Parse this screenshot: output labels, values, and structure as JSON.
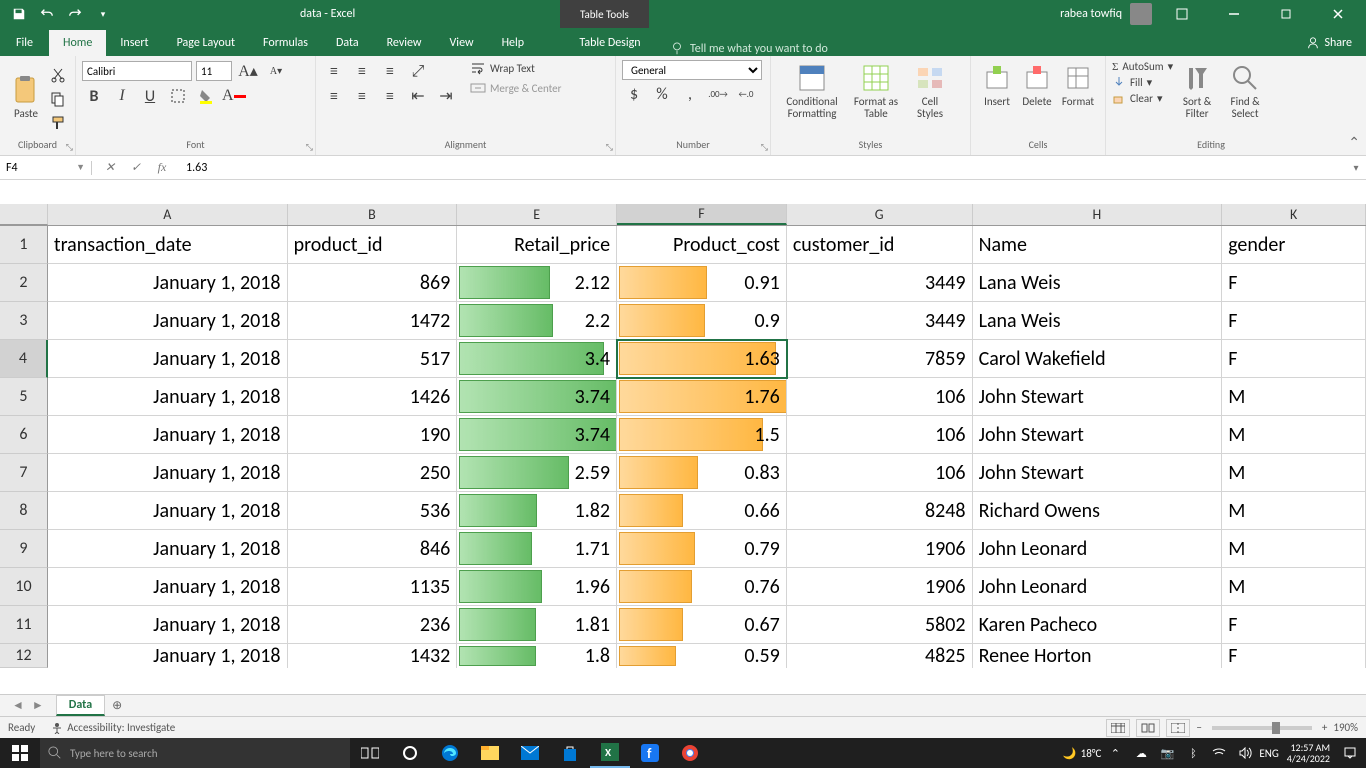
{
  "title_bar": {
    "doc_title": "data - Excel",
    "table_tools": "Table Tools",
    "user_name": "rabea towfiq"
  },
  "tabs": {
    "file": "File",
    "home": "Home",
    "insert": "Insert",
    "page_layout": "Page Layout",
    "formulas": "Formulas",
    "data": "Data",
    "review": "Review",
    "view": "View",
    "help": "Help",
    "table_design": "Table Design",
    "tell_me": "Tell me what you want to do",
    "share": "Share"
  },
  "ribbon": {
    "clipboard": {
      "label": "Clipboard",
      "paste": "Paste"
    },
    "font": {
      "label": "Font",
      "name": "Calibri",
      "size": "11"
    },
    "alignment": {
      "label": "Alignment",
      "wrap": "Wrap Text",
      "merge": "Merge & Center"
    },
    "number": {
      "label": "Number",
      "format": "General"
    },
    "styles": {
      "label": "Styles",
      "cond": "Conditional Formatting",
      "table": "Format as Table",
      "cell": "Cell Styles"
    },
    "cells": {
      "label": "Cells",
      "insert": "Insert",
      "delete": "Delete",
      "format": "Format"
    },
    "editing": {
      "label": "Editing",
      "autosum": "AutoSum",
      "fill": "Fill",
      "clear": "Clear",
      "sort": "Sort & Filter",
      "find": "Find & Select"
    }
  },
  "formula_bar": {
    "name_box": "F4",
    "formula": "1.63"
  },
  "columns": {
    "A": "A",
    "B": "B",
    "E": "E",
    "F": "F",
    "G": "G",
    "H": "H",
    "K": "K"
  },
  "headers": {
    "A": "transaction_date",
    "B": "product_id",
    "E": "Retail_price",
    "F": "Product_cost",
    "G": "customer_id",
    "H": "Name",
    "K": "gender"
  },
  "rows": [
    {
      "n": "2",
      "A": "January 1, 2018",
      "B": "869",
      "E": "2.12",
      "F": "0.91",
      "G": "3449",
      "H": "Lana Weis",
      "K": "F"
    },
    {
      "n": "3",
      "A": "January 1, 2018",
      "B": "1472",
      "E": "2.2",
      "F": "0.9",
      "G": "3449",
      "H": "Lana Weis",
      "K": "F"
    },
    {
      "n": "4",
      "A": "January 1, 2018",
      "B": "517",
      "E": "3.4",
      "F": "1.63",
      "G": "7859",
      "H": "Carol Wakefield",
      "K": "F"
    },
    {
      "n": "5",
      "A": "January 1, 2018",
      "B": "1426",
      "E": "3.74",
      "F": "1.76",
      "G": "106",
      "H": "John Stewart",
      "K": "M"
    },
    {
      "n": "6",
      "A": "January 1, 2018",
      "B": "190",
      "E": "3.74",
      "F": "1.5",
      "G": "106",
      "H": "John Stewart",
      "K": "M"
    },
    {
      "n": "7",
      "A": "January 1, 2018",
      "B": "250",
      "E": "2.59",
      "F": "0.83",
      "G": "106",
      "H": "John Stewart",
      "K": "M"
    },
    {
      "n": "8",
      "A": "January 1, 2018",
      "B": "536",
      "E": "1.82",
      "F": "0.66",
      "G": "8248",
      "H": "Richard Owens",
      "K": "M"
    },
    {
      "n": "9",
      "A": "January 1, 2018",
      "B": "846",
      "E": "1.71",
      "F": "0.79",
      "G": "1906",
      "H": "John Leonard",
      "K": "M"
    },
    {
      "n": "10",
      "A": "January 1, 2018",
      "B": "1135",
      "E": "1.96",
      "F": "0.76",
      "G": "1906",
      "H": "John Leonard",
      "K": "M"
    },
    {
      "n": "11",
      "A": "January 1, 2018",
      "B": "236",
      "E": "1.81",
      "F": "0.67",
      "G": "5802",
      "H": "Karen Pacheco",
      "K": "F"
    },
    {
      "n": "12",
      "A": "January 1, 2018",
      "B": "1432",
      "E": "1.8",
      "F": "0.59",
      "G": "4825",
      "H": "Renee Horton",
      "K": "F"
    }
  ],
  "row_header_1": "1",
  "data_bar_max": {
    "E": 3.74,
    "F": 1.76
  },
  "sheet_tabs": {
    "active": "Data"
  },
  "status_bar": {
    "ready": "Ready",
    "accessibility": "Accessibility: Investigate",
    "zoom": "190%"
  },
  "taskbar": {
    "search_placeholder": "Type here to search",
    "weather": "18°C",
    "lang": "ENG",
    "time": "12:57 AM",
    "date": "4/24/2022"
  }
}
